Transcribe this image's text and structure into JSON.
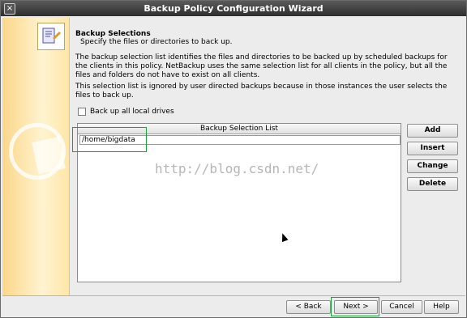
{
  "window": {
    "title": "Backup Policy Configuration Wizard"
  },
  "header": {
    "title": "Backup Selections",
    "subtitle": "Specify the files or directories to back up."
  },
  "body": {
    "para1": "The backup selection list identifies the files and directories to be backed up by scheduled backups for the clients in this policy. NetBackup uses the same selection list for all clients in the policy, but all the files and folders do not have to exist on all clients.",
    "para2": "This selection list is ignored by user directed backups because in those instances the user selects the files to back up.",
    "checkbox_label": "Back up all local drives"
  },
  "selection_list": {
    "header": "Backup Selection List",
    "items": [
      "/home/bigdata"
    ]
  },
  "side_buttons": {
    "add": "Add",
    "insert": "Insert",
    "change": "Change",
    "delete": "Delete"
  },
  "footer_buttons": {
    "back": "< Back",
    "next": "Next >",
    "cancel": "Cancel",
    "help": "Help"
  },
  "watermark": "http://blog.csdn.net/",
  "colors": {
    "highlight": "#1aa03a",
    "title_bar": "#3c3c3c",
    "side_panel": "#fbd78a"
  }
}
